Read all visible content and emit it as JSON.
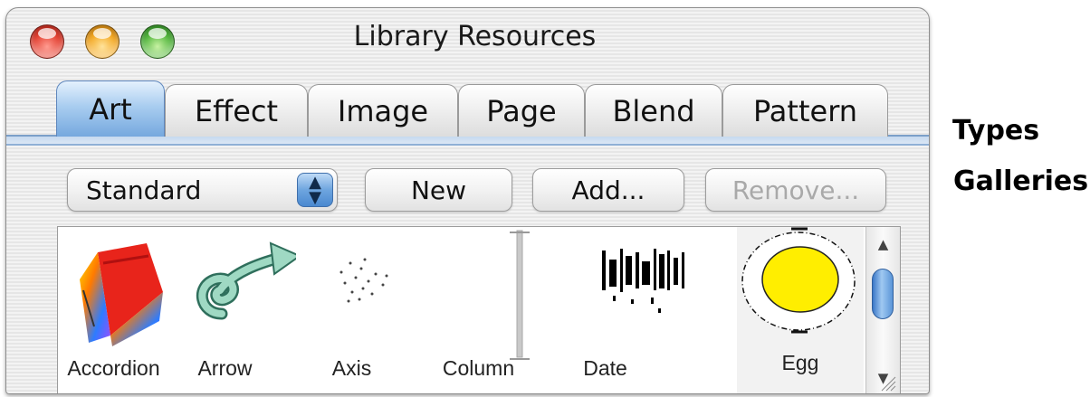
{
  "window": {
    "title": "Library Resources"
  },
  "tabs": [
    {
      "label": "Art",
      "active": true
    },
    {
      "label": "Effect",
      "active": false
    },
    {
      "label": "Image",
      "active": false
    },
    {
      "label": "Page",
      "active": false
    },
    {
      "label": "Blend",
      "active": false
    },
    {
      "label": "Pattern",
      "active": false
    }
  ],
  "toolbar": {
    "gallery_select_value": "Standard",
    "new_label": "New",
    "add_label": "Add...",
    "remove_label": "Remove...",
    "remove_enabled": false
  },
  "gallery": {
    "items": [
      {
        "label": "Accordion",
        "icon": "accordion-art-icon"
      },
      {
        "label": "Arrow",
        "icon": "arrow-art-icon"
      },
      {
        "label": "Axis",
        "icon": "axis-art-icon"
      },
      {
        "label": "Column",
        "icon": "column-art-icon"
      },
      {
        "label": "Date",
        "icon": "date-art-icon"
      },
      {
        "label": "Egg",
        "icon": "egg-art-icon",
        "selected": true
      }
    ]
  },
  "annotations": {
    "types": "Types",
    "galleries": "Galleries"
  },
  "colors": {
    "active_tab": "#8fbbe8",
    "egg_yolk": "#ffee00",
    "scroll_thumb": "#5b96d8"
  }
}
